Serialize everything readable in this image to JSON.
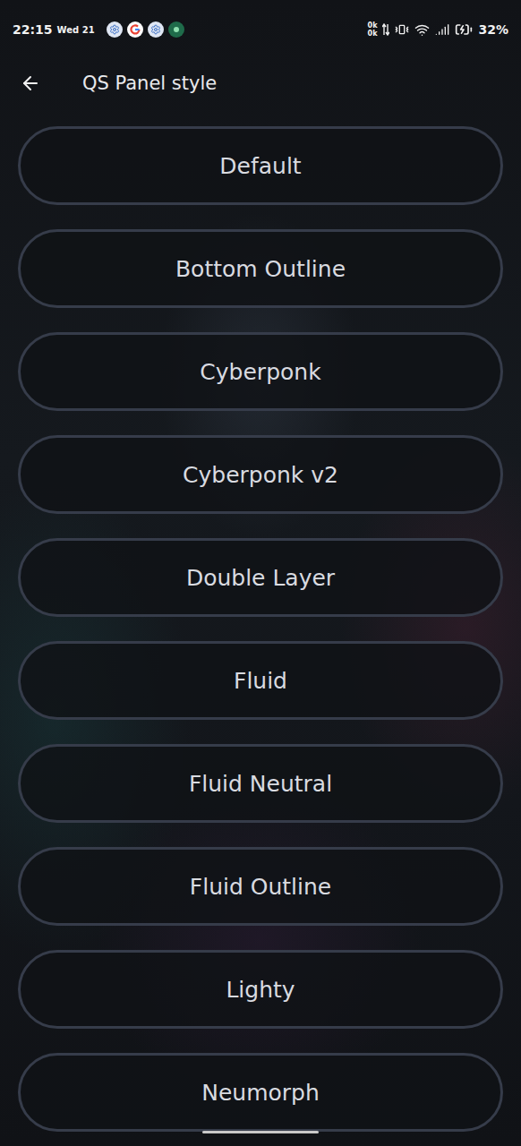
{
  "status_bar": {
    "time": "22:15",
    "date": "Wed 21",
    "net_up": "0k",
    "net_down": "0k",
    "battery": "32%"
  },
  "header": {
    "title": "QS Panel style"
  },
  "options": [
    {
      "label": "Default"
    },
    {
      "label": "Bottom Outline"
    },
    {
      "label": "Cyberponk"
    },
    {
      "label": "Cyberponk v2"
    },
    {
      "label": "Double Layer"
    },
    {
      "label": "Fluid"
    },
    {
      "label": "Fluid Neutral"
    },
    {
      "label": "Fluid Outline"
    },
    {
      "label": "Lighty"
    },
    {
      "label": "Neumorph"
    }
  ]
}
